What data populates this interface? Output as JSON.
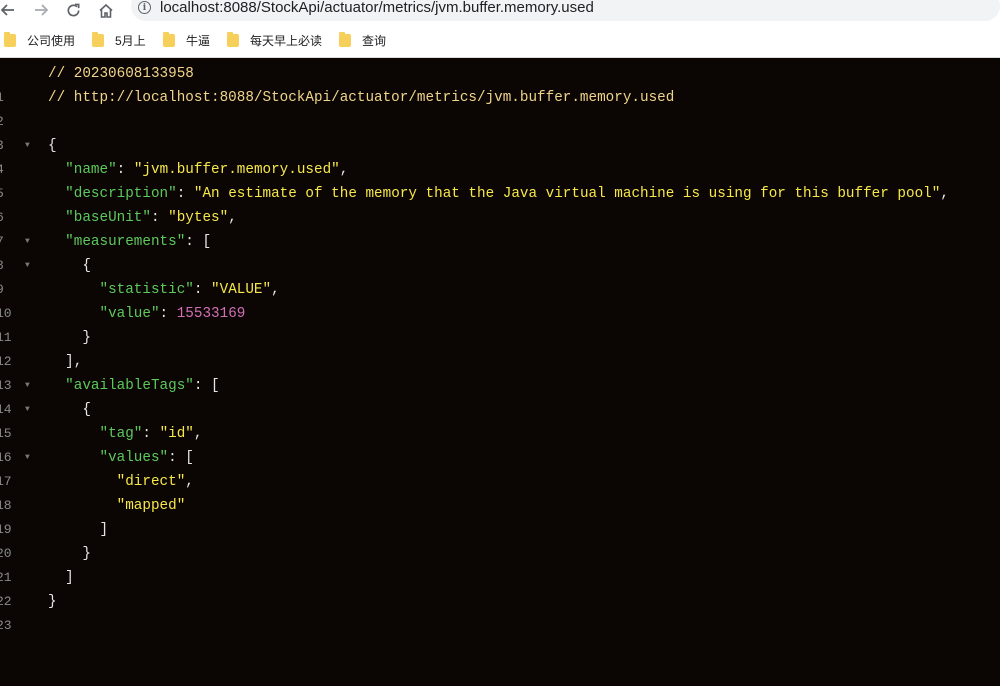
{
  "browser": {
    "url": "localhost:8088/StockApi/actuator/metrics/jvm.buffer.memory.used",
    "back_icon": "back-arrow-icon",
    "forward_icon": "forward-arrow-icon",
    "reload_icon": "reload-icon",
    "home_icon": "home-icon",
    "info_icon": "info-circle-icon"
  },
  "bookmarks": [
    {
      "label": "公司使用"
    },
    {
      "label": "5月上"
    },
    {
      "label": "牛逼"
    },
    {
      "label": "每天早上必读"
    },
    {
      "label": "查询"
    }
  ],
  "json_viewer": {
    "line_numbers": [
      "1",
      "2",
      "3",
      "4",
      "5",
      "6",
      "7",
      "8",
      "9",
      "10",
      "11",
      "12",
      "13",
      "14",
      "15",
      "16",
      "17",
      "18",
      "19",
      "20",
      "21",
      "22",
      "23"
    ],
    "comment_timestamp": "// 20230608133958",
    "comment_url": "// http://localhost:8088/StockApi/actuator/metrics/jvm.buffer.memory.used",
    "name_key": "\"name\"",
    "name_value": "\"jvm.buffer.memory.used\"",
    "description_key": "\"description\"",
    "description_value": "\"An estimate of the memory that the Java virtual machine is using for this buffer pool\"",
    "baseUnit_key": "\"baseUnit\"",
    "baseUnit_value": "\"bytes\"",
    "measurements_key": "\"measurements\"",
    "statistic_key": "\"statistic\"",
    "statistic_value": "\"VALUE\"",
    "value_key": "\"value\"",
    "value_value": "15533169",
    "availableTags_key": "\"availableTags\"",
    "tag_key": "\"tag\"",
    "tag_value": "\"id\"",
    "values_key": "\"values\"",
    "values_item1": "\"direct\"",
    "values_item2": "\"mapped\""
  },
  "colors": {
    "background": "#0b0604",
    "key": "#5cc95b",
    "string": "#f7e84a",
    "number": "#d36fb5",
    "comment": "#f0d48a"
  }
}
